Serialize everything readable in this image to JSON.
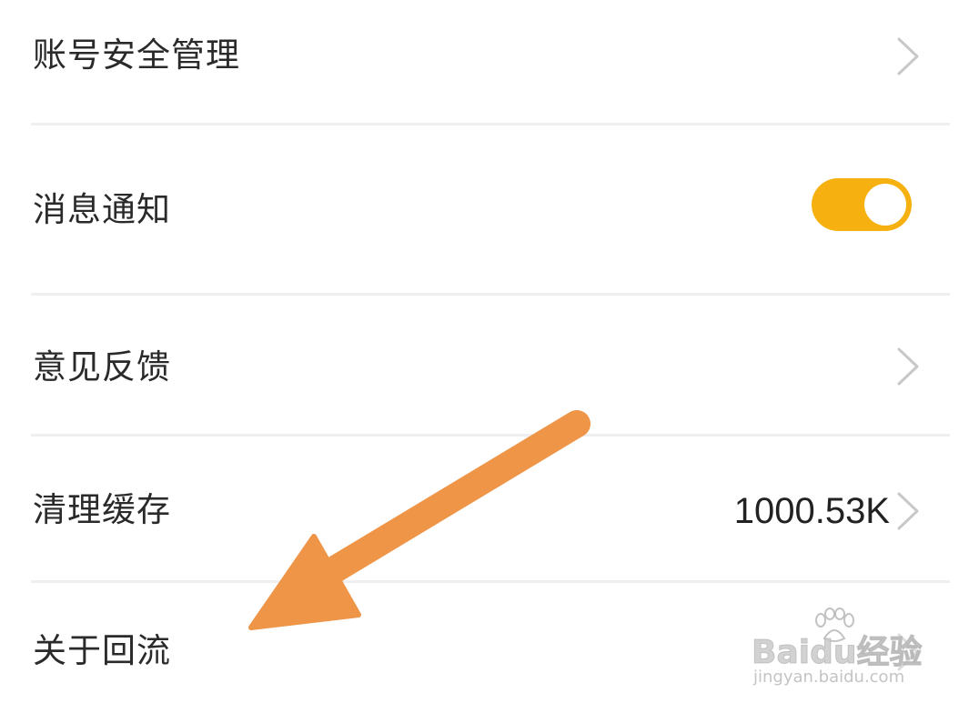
{
  "settings": {
    "items": [
      {
        "label": "账号安全管理",
        "type": "link"
      },
      {
        "label": "消息通知",
        "type": "toggle",
        "enabled": true
      },
      {
        "label": "意见反馈",
        "type": "link"
      },
      {
        "label": "清理缓存",
        "type": "link",
        "value": "1000.53K"
      },
      {
        "label": "关于回流",
        "type": "link"
      }
    ]
  },
  "colors": {
    "toggle_on": "#f6b111",
    "arrow": "#ee9548",
    "divider": "#efefef"
  },
  "watermark": {
    "brand": "Baidu经验",
    "url": "jingyan.baidu.com"
  }
}
